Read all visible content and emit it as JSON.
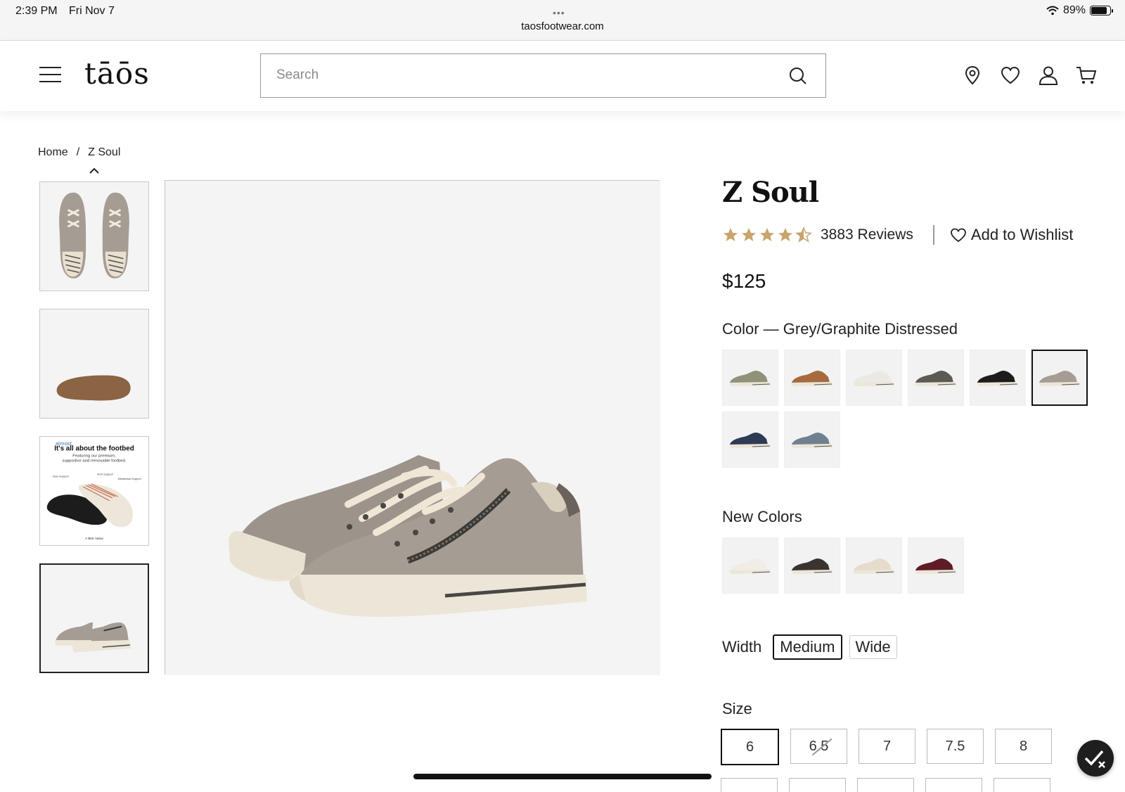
{
  "status_bar": {
    "time": "2:39 PM",
    "date": "Fri Nov 7",
    "url": "taosfootwear.com",
    "battery": "89%",
    "dots": "•••"
  },
  "header": {
    "logo": "tāōs",
    "search_placeholder": "Search"
  },
  "breadcrumb": {
    "home": "Home",
    "separator": "/",
    "current": "Z Soul"
  },
  "thumbnails": [
    {
      "name": "top-view"
    },
    {
      "name": "sole-view"
    },
    {
      "name": "footbed-infographic",
      "lines": [
        "almost",
        "It's all about the footbed",
        "Featuring our premium,",
        "supportive and removable footbed.",
        "Heel Support",
        "Arch Support",
        "Metatarsal Support",
        "A $50 Value"
      ]
    },
    {
      "name": "side-view"
    }
  ],
  "product": {
    "title": "Z Soul",
    "rating": 4.5,
    "reviews": "3883 Reviews",
    "wishlist": "Add to Wishlist",
    "price": "$125",
    "color_label": "Color — Grey/Graphite Distressed",
    "new_colors_label": "New Colors",
    "width_label": "Width",
    "width_options": [
      "Medium",
      "Wide"
    ],
    "size_label": "Size",
    "sizes": [
      "6",
      "6.5",
      "7",
      "7.5",
      "8"
    ]
  },
  "colors": {
    "swatches": [
      "#8f9278",
      "#a76a3e",
      "#e9e9e6",
      "#5c5a55",
      "#1c1c1c",
      "#a59c93",
      "#2f3a55",
      "#6f8190"
    ],
    "new_swatches": [
      "#f0ede7",
      "#3a3430",
      "#e6dccb",
      "#5e1c26"
    ],
    "accent": "#c9a46b"
  }
}
